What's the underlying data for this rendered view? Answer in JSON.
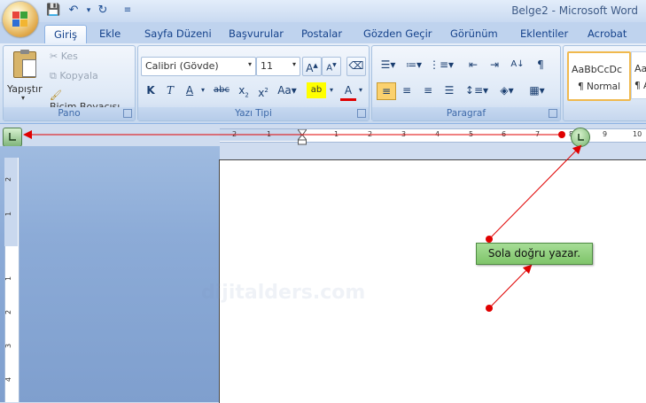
{
  "titlebar": {
    "doc_title": "Belge2 - Microsoft Word"
  },
  "tabs": [
    "Giriş",
    "Ekle",
    "Sayfa Düzeni",
    "Başvurular",
    "Postalar",
    "Gözden Geçir",
    "Görünüm",
    "Eklentiler",
    "Acrobat"
  ],
  "clipboard": {
    "paste_label": "Yapıştır",
    "cut_label": "Kes",
    "copy_label": "Kopyala",
    "format_painter_label": "Biçim Boyacısı",
    "group_label": "Pano"
  },
  "font": {
    "font_name": "Calibri (Gövde)",
    "font_size": "11",
    "group_label": "Yazı Tipi"
  },
  "paragraph": {
    "group_label": "Paragraf"
  },
  "styles": {
    "style1_preview": "AaBbCcDc",
    "style1_name": "¶ Normal",
    "style2_preview": "AaB",
    "style2_name": "¶ A"
  },
  "ruler": {
    "numbers": [
      "2",
      "1",
      "1",
      "2",
      "3",
      "4",
      "5",
      "6",
      "7",
      "8",
      "9",
      "10"
    ]
  },
  "vruler": {
    "numbers": [
      "2",
      "1",
      "1",
      "2",
      "3",
      "4"
    ]
  },
  "watermark": "dijitalders.com",
  "annotation": {
    "text": "Sola doğru yazar."
  },
  "colors": {
    "annotation_bg": "#8fd17c",
    "arrow": "#e00000",
    "accent": "#15428b"
  }
}
